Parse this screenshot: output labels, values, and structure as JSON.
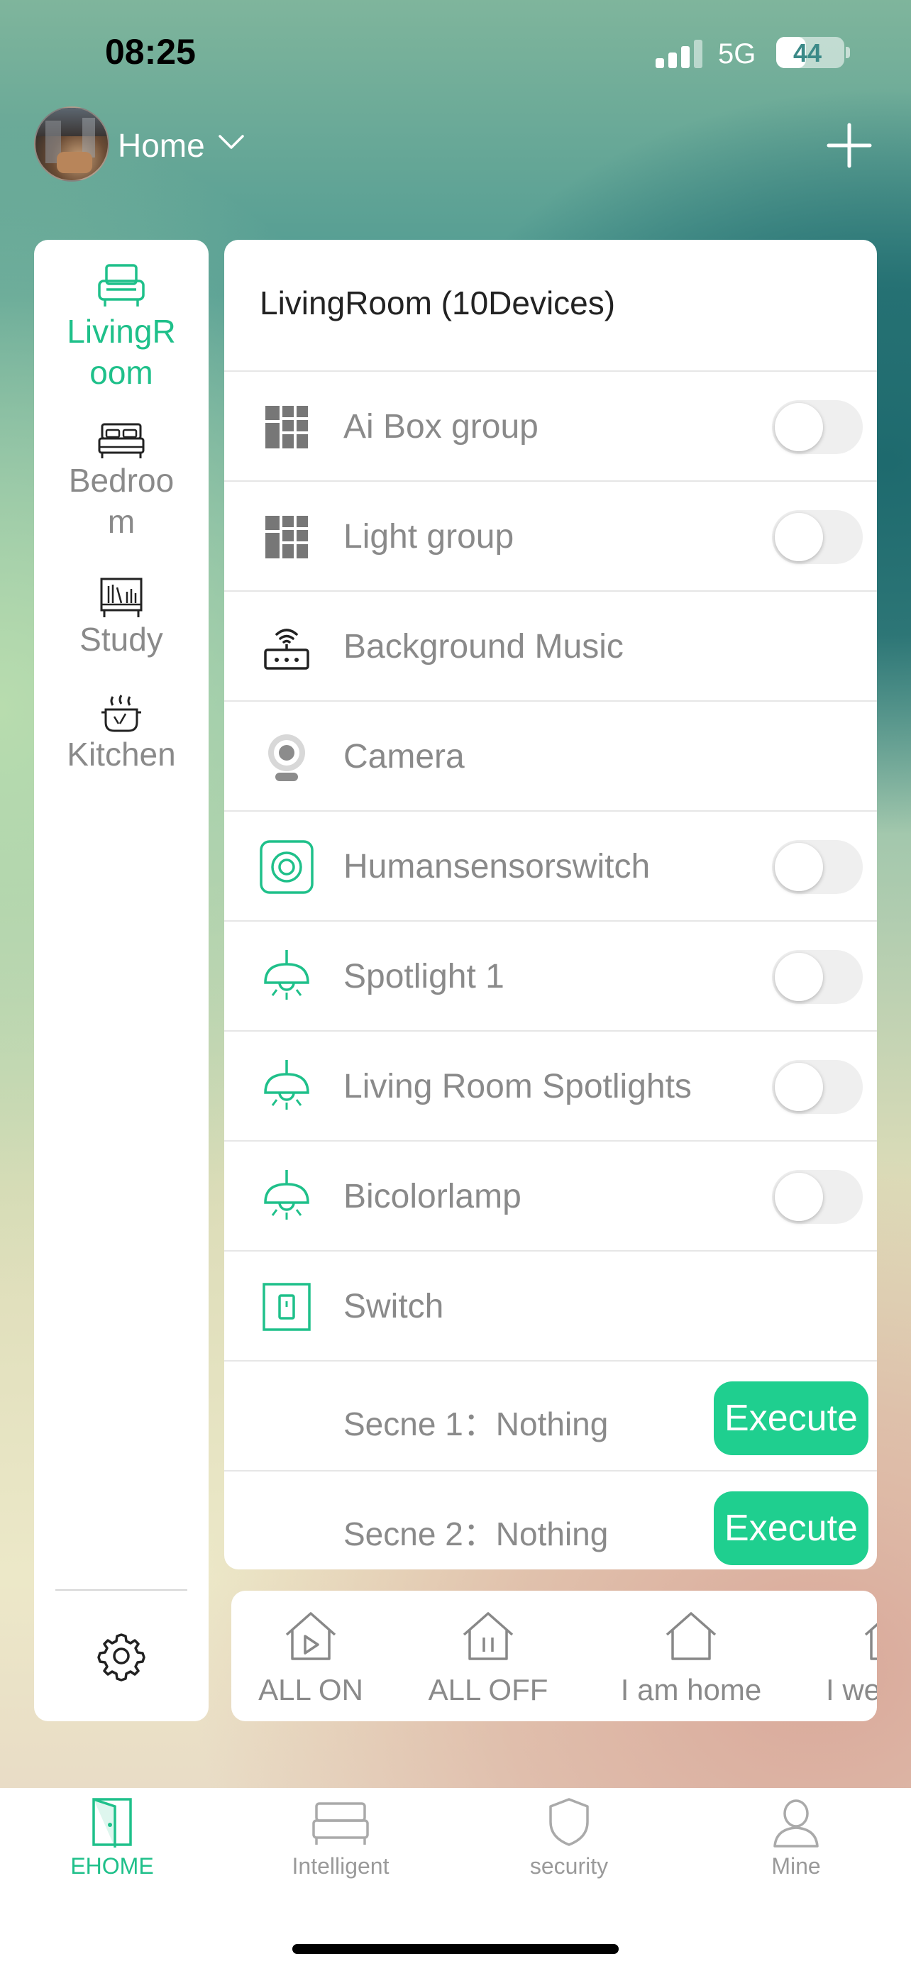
{
  "status": {
    "time": "08:25",
    "network": "5G",
    "battery": "44",
    "battery_level": 0.44
  },
  "header": {
    "title": "Home",
    "avatar_icon": "avatar",
    "chevron_icon": "chevron-down-icon",
    "add_icon": "plus-icon"
  },
  "rooms": {
    "items": [
      {
        "label": "LivingR\noom",
        "icon": "sofa-icon",
        "active": true
      },
      {
        "label": "Bedroo\nm",
        "icon": "bed-icon",
        "active": false
      },
      {
        "label": "Study",
        "icon": "bookshelf-icon",
        "active": false
      },
      {
        "label": "Kitchen",
        "icon": "cooking-pot-icon",
        "active": false
      }
    ],
    "settings_icon": "gear-icon",
    "active_color": "#1fc08a"
  },
  "devices": {
    "title": "LivingRoom (10Devices)",
    "items": [
      {
        "label": "Ai Box group",
        "icon": "grid-group-icon",
        "toggle": true
      },
      {
        "label": "Light group",
        "icon": "grid-group-icon",
        "toggle": true
      },
      {
        "label": "Background Music",
        "icon": "router-music-icon",
        "toggle": false
      },
      {
        "label": "Camera",
        "icon": "camera-icon",
        "toggle": false
      },
      {
        "label": "Humansensorswitch",
        "icon": "human-sensor-icon",
        "toggle": true
      },
      {
        "label": "Spotlight 1",
        "icon": "ceiling-lamp-icon",
        "toggle": true
      },
      {
        "label": "Living Room Spotlights",
        "icon": "ceiling-lamp-icon",
        "toggle": true
      },
      {
        "label": "Bicolorlamp",
        "icon": "ceiling-lamp-icon",
        "toggle": true
      },
      {
        "label": "Switch",
        "icon": "wall-switch-icon",
        "toggle": false
      }
    ],
    "scenes": [
      {
        "label": "Secne 1：Nothing",
        "button": "Execute"
      },
      {
        "label": "Secne 2：Nothing",
        "button": "Execute"
      }
    ],
    "accent": "#1fcf8f"
  },
  "quick_scenes": [
    {
      "label": "ALL ON",
      "icon": "house-play-icon"
    },
    {
      "label": "ALL OFF",
      "icon": "house-pause-icon"
    },
    {
      "label": "I am home",
      "icon": "house-icon"
    },
    {
      "label": "I we",
      "icon": "house-icon"
    }
  ],
  "tabs": [
    {
      "label": "EHOME",
      "icon": "door-icon",
      "active": true
    },
    {
      "label": "Intelligent",
      "icon": "bed-icon",
      "active": false
    },
    {
      "label": "security",
      "icon": "shield-icon",
      "active": false
    },
    {
      "label": "Mine",
      "icon": "user-icon",
      "active": false
    }
  ]
}
